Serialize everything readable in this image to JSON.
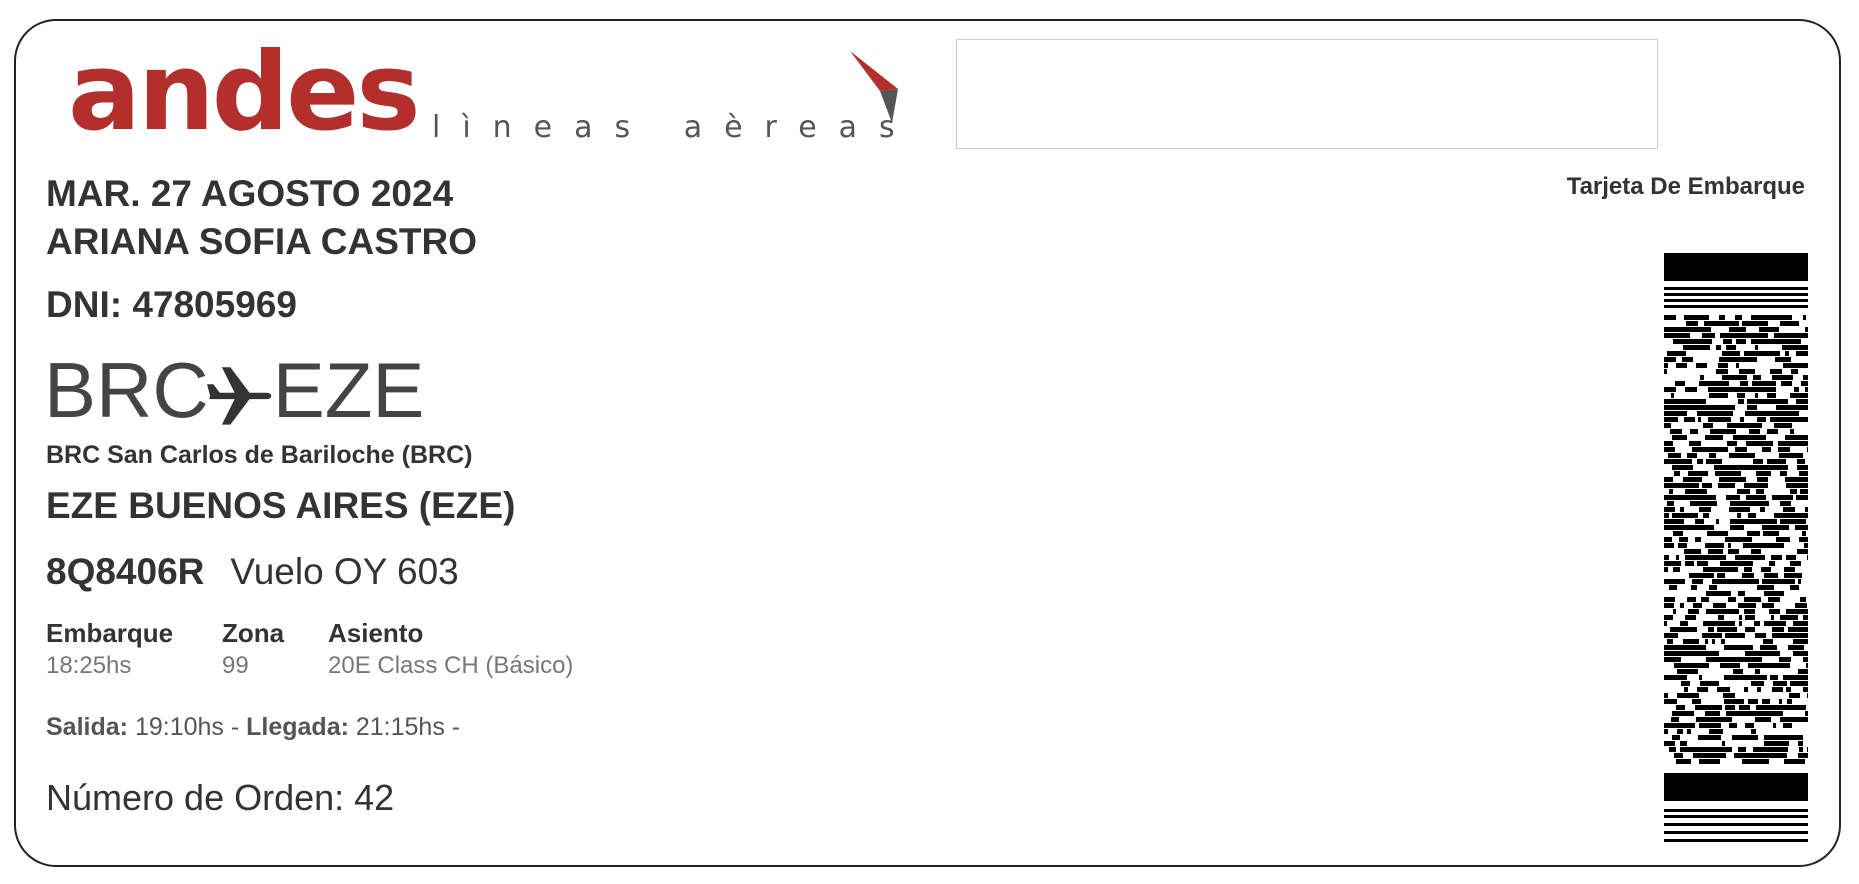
{
  "airline": {
    "logo_word": "andes",
    "logo_tagline": "lìneas aèreas",
    "brand_color": "#b22f2c"
  },
  "document_label": "Tarjeta De Embarque",
  "flight_date": "MAR. 27 AGOSTO 2024",
  "passenger": {
    "name": "ARIANA SOFIA CASTRO",
    "dni": "DNI: 47805969"
  },
  "route": {
    "from_code": "BRC",
    "to_code": "EZE",
    "plane_icon": "airplane-icon",
    "origin_full": "BRC San Carlos de Bariloche (BRC)",
    "destination_full": "EZE BUENOS AIRES (EZE)"
  },
  "booking": {
    "code": "8Q8406R",
    "flight": "Vuelo OY 603"
  },
  "details": {
    "boarding_label": "Embarque",
    "boarding_value": "18:25hs",
    "zone_label": "Zona",
    "zone_value": "99",
    "seat_label": "Asiento",
    "seat_value": "20E Class CH (Básico)"
  },
  "times": {
    "departure_label": "Salida:",
    "departure_value": "19:10hs",
    "arrival_label": "Llegada:",
    "arrival_value": "21:15hs"
  },
  "order": "Número de Orden: 42"
}
